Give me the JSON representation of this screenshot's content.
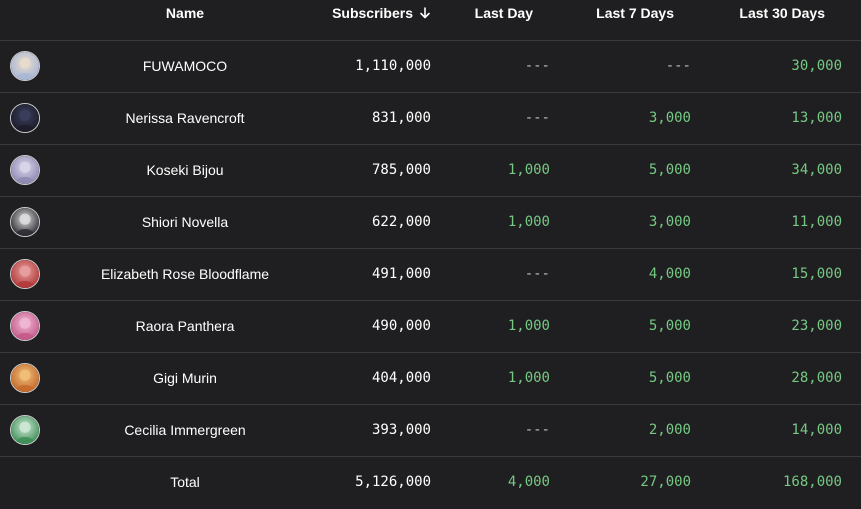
{
  "colors": {
    "background": "#1f1f21",
    "divider": "#3a3a3d",
    "positive": "#76c983",
    "dash": "#bdbdbd",
    "text": "#ffffff"
  },
  "headers": {
    "name": "Name",
    "subscribers": "Subscribers",
    "sort_icon": "arrow-down-icon",
    "last_day": "Last Day",
    "last_7_days": "Last 7 Days",
    "last_30_days": "Last 30 Days"
  },
  "rows": [
    {
      "name": "FUWAMOCO",
      "subscribers": "1,110,000",
      "last_day": "---",
      "last_7_days": "---",
      "last_30_days": "30,000",
      "avatar_colors": [
        "#e9dccc",
        "#a9b7d6"
      ]
    },
    {
      "name": "Nerissa Ravencroft",
      "subscribers": "831,000",
      "last_day": "---",
      "last_7_days": "3,000",
      "last_30_days": "13,000",
      "avatar_colors": [
        "#3a3f5c",
        "#1c1c2a"
      ]
    },
    {
      "name": "Koseki Bijou",
      "subscribers": "785,000",
      "last_day": "1,000",
      "last_7_days": "5,000",
      "last_30_days": "34,000",
      "avatar_colors": [
        "#d9d6ea",
        "#8f8ab3"
      ]
    },
    {
      "name": "Shiori Novella",
      "subscribers": "622,000",
      "last_day": "1,000",
      "last_7_days": "3,000",
      "last_30_days": "11,000",
      "avatar_colors": [
        "#dedede",
        "#2e2e36"
      ]
    },
    {
      "name": "Elizabeth Rose Bloodflame",
      "subscribers": "491,000",
      "last_day": "---",
      "last_7_days": "4,000",
      "last_30_days": "15,000",
      "avatar_colors": [
        "#e6a0a0",
        "#b33a3a"
      ]
    },
    {
      "name": "Raora Panthera",
      "subscribers": "490,000",
      "last_day": "1,000",
      "last_7_days": "5,000",
      "last_30_days": "23,000",
      "avatar_colors": [
        "#f0b8d4",
        "#c45a8a"
      ]
    },
    {
      "name": "Gigi Murin",
      "subscribers": "404,000",
      "last_day": "1,000",
      "last_7_days": "5,000",
      "last_30_days": "28,000",
      "avatar_colors": [
        "#f1c07a",
        "#c46a2c"
      ]
    },
    {
      "name": "Cecilia Immergreen",
      "subscribers": "393,000",
      "last_day": "---",
      "last_7_days": "2,000",
      "last_30_days": "14,000",
      "avatar_colors": [
        "#cfe9d5",
        "#3f8f5a"
      ]
    }
  ],
  "total": {
    "label": "Total",
    "subscribers": "5,126,000",
    "last_day": "4,000",
    "last_7_days": "27,000",
    "last_30_days": "168,000"
  }
}
